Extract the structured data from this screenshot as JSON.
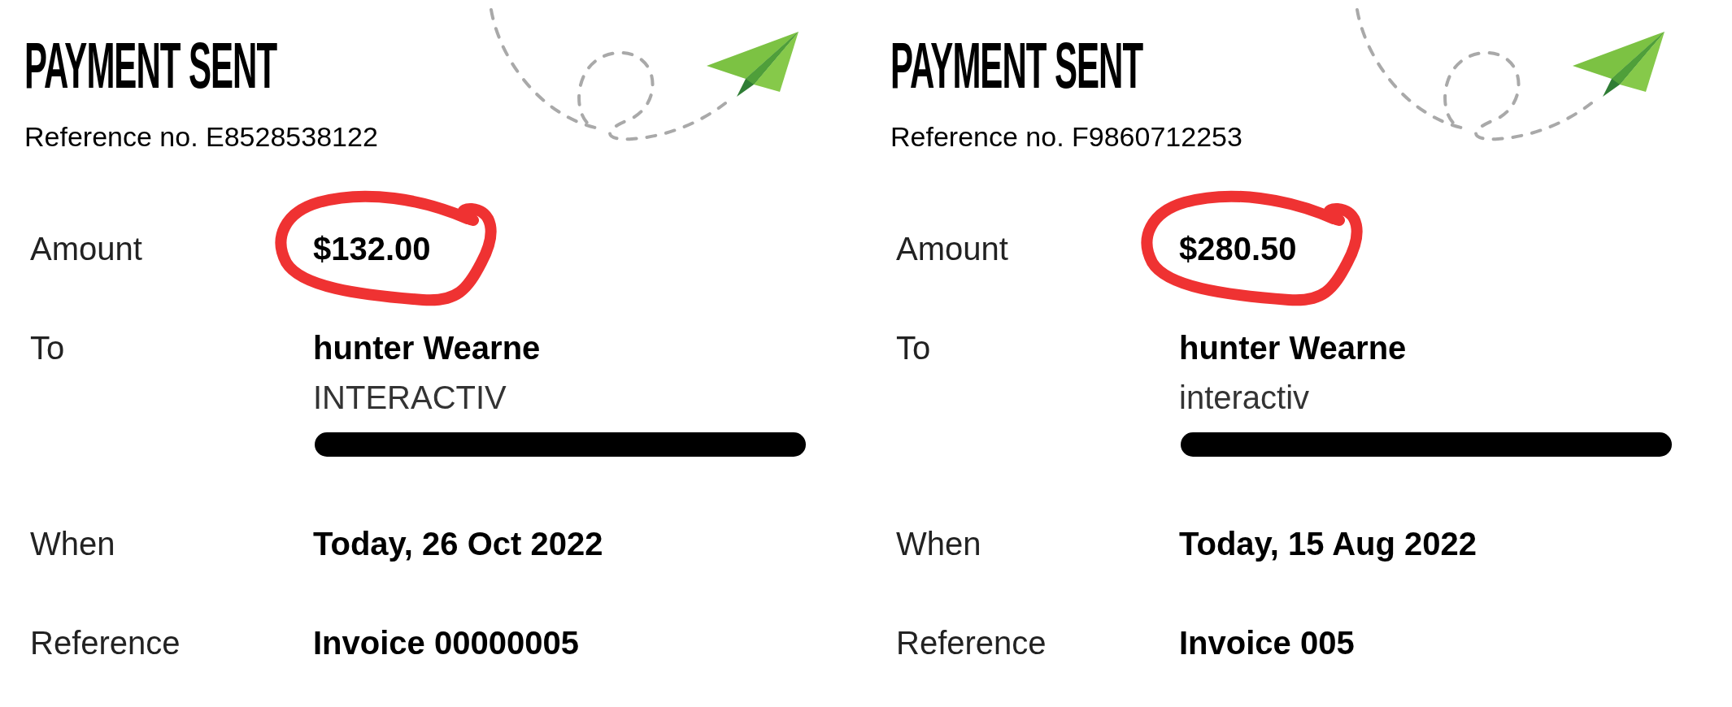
{
  "receipts": [
    {
      "title": "PAYMENT SENT",
      "reference_no": "Reference no. E8528538122",
      "rows": [
        {
          "kind": "amount",
          "label": "Amount",
          "value": "$132.00",
          "circled": true
        },
        {
          "kind": "payee",
          "label": "To",
          "name": "hunter Wearne",
          "detail": "INTERACTIV",
          "redacted": true
        },
        {
          "kind": "text",
          "label": "When",
          "value": "Today, 26 Oct 2022"
        },
        {
          "kind": "text",
          "label": "Reference",
          "value": "Invoice 00000005"
        }
      ]
    },
    {
      "title": "PAYMENT SENT",
      "reference_no": "Reference no. F9860712253",
      "rows": [
        {
          "kind": "amount",
          "label": "Amount",
          "value": "$280.50",
          "circled": true
        },
        {
          "kind": "payee",
          "label": "To",
          "name": "hunter Wearne",
          "detail": "interactiv",
          "redacted": true
        },
        {
          "kind": "text",
          "label": "When",
          "value": "Today, 15 Aug 2022"
        },
        {
          "kind": "text",
          "label": "Reference",
          "value": "Invoice 005"
        }
      ]
    }
  ]
}
